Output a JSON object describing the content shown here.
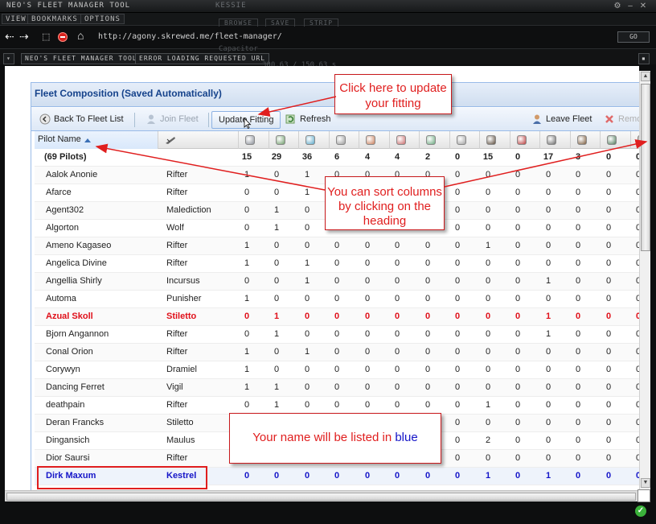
{
  "window": {
    "title": "NEO'S FLEET MANAGER TOOL",
    "ghost_title": "KESSIE",
    "menu": [
      "VIEW",
      "BOOKMARKS",
      "OPTIONS"
    ],
    "ghost_buttons": [
      "BROWSE",
      "SAVE",
      "STRIP"
    ],
    "ghost_capacitor": "Capacitor",
    "ghost_stat": "300.63 / 150.63 s"
  },
  "browser": {
    "url": "http://agony.skrewed.me/fleet-manager/",
    "go_label": "GO",
    "tabs": [
      "NEO'S FLEET MANAGER TOOL",
      "ERROR LOADING REQUESTED URL"
    ]
  },
  "panel": {
    "title": "Fleet Composition (Saved Automatically)",
    "toolbar": {
      "back": "Back To Fleet List",
      "join": "Join Fleet",
      "update": "Update Fitting",
      "refresh": "Refresh",
      "leave": "Leave Fleet",
      "remove": "Remo"
    },
    "pilot_header": "Pilot Name",
    "module_colors": [
      "#8a8f98",
      "#6e9c6a",
      "#5aa7c8",
      "#9a9a9a",
      "#c87d5a",
      "#c86a6a",
      "#6aa87e",
      "#a0a0a0",
      "#5a4a3a",
      "#b83a3a",
      "#6a6a6a",
      "#7a5a3a",
      "#4e7a5a",
      "#5a4a3a"
    ]
  },
  "grid": {
    "total": {
      "pilot": "(69 Pilots)",
      "values": [
        "15",
        "29",
        "36",
        "6",
        "4",
        "4",
        "2",
        "0",
        "15",
        "0",
        "17",
        "3",
        "0",
        "0"
      ]
    },
    "rows": [
      {
        "pilot": "Aalok Anonie",
        "ship": "Rifter",
        "values": [
          "1",
          "0",
          "1",
          "0",
          "0",
          "0",
          "0",
          "0",
          "0",
          "0",
          "0",
          "0",
          "0",
          "0"
        ]
      },
      {
        "pilot": "Afarce",
        "ship": "Rifter",
        "values": [
          "0",
          "0",
          "1",
          "0",
          "0",
          "0",
          "0",
          "0",
          "0",
          "0",
          "0",
          "0",
          "0",
          "0"
        ]
      },
      {
        "pilot": "Agent302",
        "ship": "Malediction",
        "values": [
          "0",
          "1",
          "0",
          "0",
          "0",
          "0",
          "0",
          "0",
          "0",
          "0",
          "0",
          "0",
          "0",
          "0"
        ]
      },
      {
        "pilot": "Algorton",
        "ship": "Wolf",
        "values": [
          "0",
          "1",
          "0",
          "0",
          "0",
          "0",
          "0",
          "0",
          "0",
          "0",
          "0",
          "0",
          "0",
          "0"
        ]
      },
      {
        "pilot": "Ameno Kagaseo",
        "ship": "Rifter",
        "values": [
          "1",
          "0",
          "0",
          "0",
          "0",
          "0",
          "0",
          "0",
          "1",
          "0",
          "0",
          "0",
          "0",
          "0"
        ]
      },
      {
        "pilot": "Angelica Divine",
        "ship": "Rifter",
        "values": [
          "1",
          "0",
          "1",
          "0",
          "0",
          "0",
          "0",
          "0",
          "0",
          "0",
          "0",
          "0",
          "0",
          "0"
        ]
      },
      {
        "pilot": "Angellia Shirly",
        "ship": "Incursus",
        "values": [
          "0",
          "0",
          "1",
          "0",
          "0",
          "0",
          "0",
          "0",
          "0",
          "0",
          "1",
          "0",
          "0",
          "0"
        ]
      },
      {
        "pilot": "Automa",
        "ship": "Punisher",
        "values": [
          "1",
          "0",
          "0",
          "0",
          "0",
          "0",
          "0",
          "0",
          "0",
          "0",
          "0",
          "0",
          "0",
          "0"
        ]
      },
      {
        "pilot": "Azual Skoll",
        "ship": "Stiletto",
        "values": [
          "0",
          "1",
          "0",
          "0",
          "0",
          "0",
          "0",
          "0",
          "0",
          "0",
          "1",
          "0",
          "0",
          "0"
        ],
        "style": "red"
      },
      {
        "pilot": "Bjorn Angannon",
        "ship": "Rifter",
        "values": [
          "0",
          "1",
          "0",
          "0",
          "0",
          "0",
          "0",
          "0",
          "0",
          "0",
          "1",
          "0",
          "0",
          "0"
        ]
      },
      {
        "pilot": "Conal Orion",
        "ship": "Rifter",
        "values": [
          "1",
          "0",
          "1",
          "0",
          "0",
          "0",
          "0",
          "0",
          "0",
          "0",
          "0",
          "0",
          "0",
          "0"
        ]
      },
      {
        "pilot": "Corywyn",
        "ship": "Dramiel",
        "values": [
          "1",
          "0",
          "0",
          "0",
          "0",
          "0",
          "0",
          "0",
          "0",
          "0",
          "0",
          "0",
          "0",
          "0"
        ]
      },
      {
        "pilot": "Dancing Ferret",
        "ship": "Vigil",
        "values": [
          "1",
          "1",
          "0",
          "0",
          "0",
          "0",
          "0",
          "0",
          "0",
          "0",
          "0",
          "0",
          "0",
          "0"
        ]
      },
      {
        "pilot": "deathpain",
        "ship": "Rifter",
        "values": [
          "0",
          "1",
          "0",
          "0",
          "0",
          "0",
          "0",
          "0",
          "1",
          "0",
          "0",
          "0",
          "0",
          "0"
        ]
      },
      {
        "pilot": "Deran Francks",
        "ship": "Stiletto",
        "values": [
          "",
          "",
          "",
          "",
          "",
          "",
          "",
          "0",
          "0",
          "0",
          "0",
          "0",
          "0",
          "0"
        ]
      },
      {
        "pilot": "Dingansich",
        "ship": "Maulus",
        "values": [
          "",
          "",
          "",
          "",
          "",
          "",
          "0",
          "0",
          "2",
          "0",
          "0",
          "0",
          "0",
          "0"
        ]
      },
      {
        "pilot": "Dior Saursi",
        "ship": "Rifter",
        "values": [
          "",
          "",
          "",
          "",
          "",
          "",
          "",
          "0",
          "0",
          "0",
          "0",
          "0",
          "0",
          "0"
        ]
      },
      {
        "pilot": "Dirk Maxum",
        "ship": "Kestrel",
        "values": [
          "0",
          "0",
          "0",
          "0",
          "0",
          "0",
          "0",
          "0",
          "1",
          "0",
          "1",
          "0",
          "0",
          "0"
        ],
        "style": "blue"
      }
    ]
  },
  "callouts": {
    "update": "Click here to update your fitting",
    "sort": "You can sort columns by clicking on the heading",
    "name_prefix": "Your name will be listed in ",
    "name_blue": "blue"
  }
}
